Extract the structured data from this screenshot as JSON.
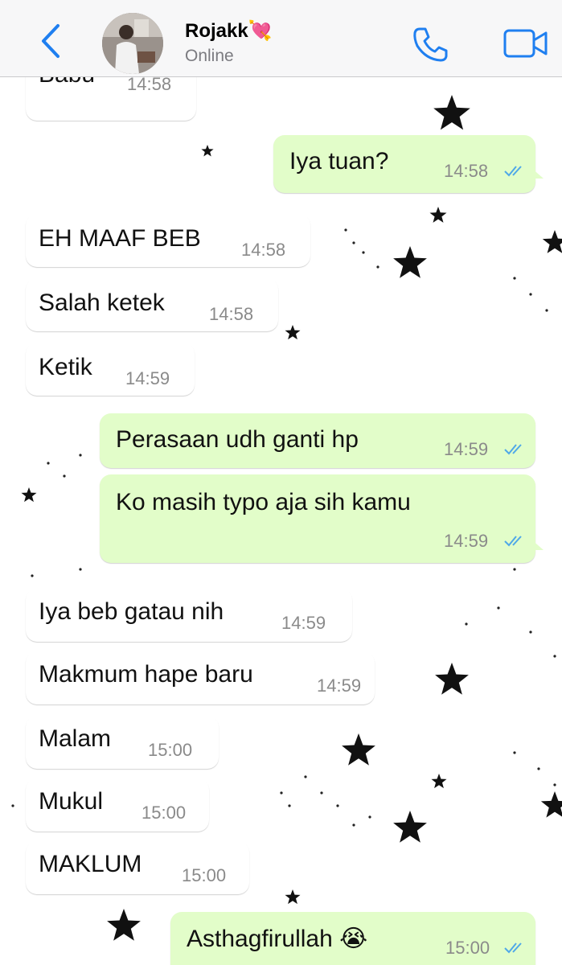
{
  "header": {
    "contact_name": "Rojakk💘",
    "status": "Online",
    "back_icon": "chevron-left-icon",
    "call_icon": "phone-icon",
    "video_icon": "video-camera-icon"
  },
  "colors": {
    "accent": "#1f7ff0",
    "incoming_bubble": "#ffffff",
    "outgoing_bubble": "#e2fdc9",
    "read_ticks": "#4fa8e8",
    "timestamp": "#8a8a8a"
  },
  "messages": [
    {
      "dir": "in",
      "text": "Babu",
      "time": "14:58"
    },
    {
      "dir": "out",
      "text": "Iya tuan?",
      "time": "14:58",
      "read": true
    },
    {
      "dir": "in",
      "text": "EH MAAF BEB",
      "time": "14:58"
    },
    {
      "dir": "in",
      "text": "Salah ketek",
      "time": "14:58"
    },
    {
      "dir": "in",
      "text": "Ketik",
      "time": "14:59"
    },
    {
      "dir": "out",
      "text": "Perasaan udh ganti hp",
      "time": "14:59",
      "read": true
    },
    {
      "dir": "out",
      "text": "Ko masih typo aja sih kamu",
      "time": "14:59",
      "read": true
    },
    {
      "dir": "in",
      "text": "Iya beb gatau nih",
      "time": "14:59"
    },
    {
      "dir": "in",
      "text": "Makmum hape baru",
      "time": "14:59"
    },
    {
      "dir": "in",
      "text": "Malam",
      "time": "15:00"
    },
    {
      "dir": "in",
      "text": "Mukul",
      "time": "15:00"
    },
    {
      "dir": "in",
      "text": "MAKLUM",
      "time": "15:00"
    },
    {
      "dir": "out",
      "text": "Asthagfirullah 😭",
      "time": "15:00",
      "read": true
    }
  ]
}
